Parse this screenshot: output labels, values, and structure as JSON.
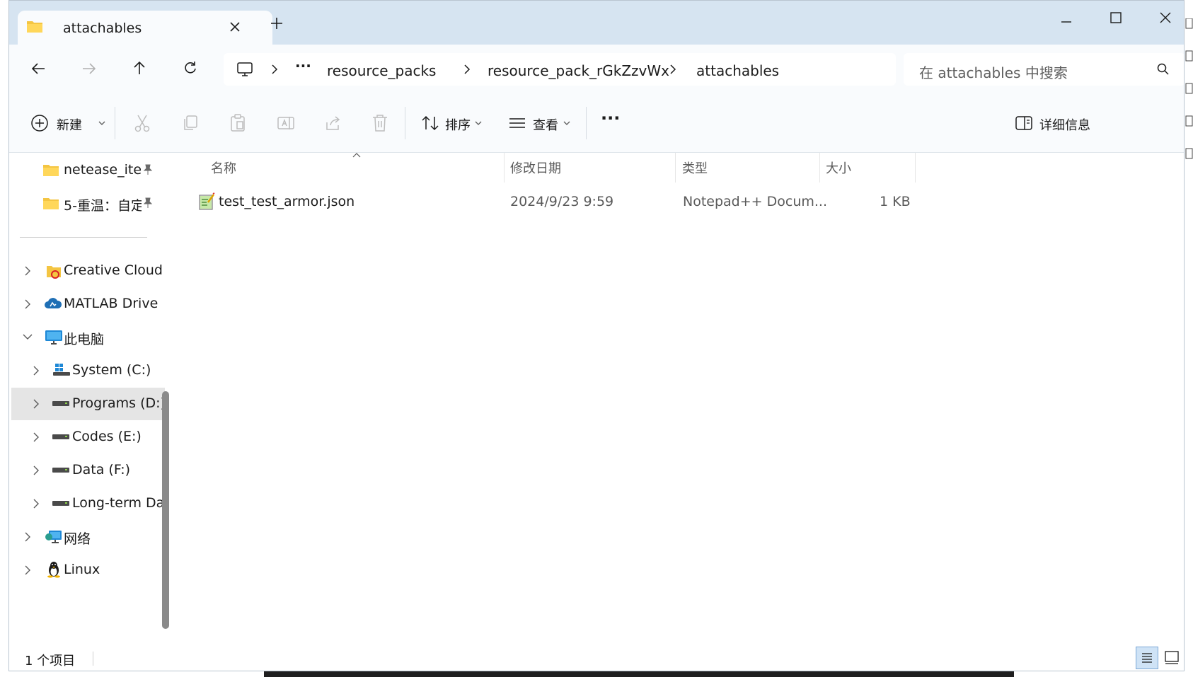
{
  "tab": {
    "title": "attachables",
    "new_tab": "+"
  },
  "window_controls": {
    "minimize": "minimize",
    "maximize": "maximize",
    "close": "close"
  },
  "breadcrumb": {
    "more": "···",
    "items": [
      "resource_packs",
      "resource_pack_rGkZzvWx",
      "attachables"
    ]
  },
  "search": {
    "placeholder": "在 attachables 中搜索"
  },
  "toolbar": {
    "new_label": "新建",
    "sort_label": "排序",
    "view_label": "查看",
    "more_label": "···",
    "details_label": "详细信息"
  },
  "sidebar": {
    "pinned": [
      {
        "label": "netease_iten",
        "icon": "folder-icon"
      },
      {
        "label": "5-重温：自定",
        "icon": "folder-icon"
      }
    ],
    "items": [
      {
        "label": "Creative Cloud",
        "icon": "creative-cloud-icon"
      },
      {
        "label": "MATLAB Drive",
        "icon": "cloud-drive-icon"
      },
      {
        "label": "此电脑",
        "icon": "computer-icon"
      },
      {
        "label": "System (C:)",
        "icon": "windows-drive-icon"
      },
      {
        "label": "Programs (D:)",
        "icon": "drive-icon"
      },
      {
        "label": "Codes (E:)",
        "icon": "drive-icon"
      },
      {
        "label": "Data (F:)",
        "icon": "drive-icon"
      },
      {
        "label": "Long-term Da",
        "icon": "drive-icon"
      },
      {
        "label": "网络",
        "icon": "network-icon"
      },
      {
        "label": "Linux",
        "icon": "linux-penguin-icon"
      }
    ]
  },
  "columns": {
    "name": "名称",
    "modified": "修改日期",
    "type": "类型",
    "size": "大小"
  },
  "files": [
    {
      "name": "test_test_armor.json",
      "modified": "2024/9/23 9:59",
      "type": "Notepad++ Docum...",
      "size": "1 KB"
    }
  ],
  "status": {
    "count": "1 个项目"
  },
  "colors": {
    "titlebar": "#d6e4f1",
    "selection": "#e5e5e5",
    "accent": "#0067c0"
  }
}
